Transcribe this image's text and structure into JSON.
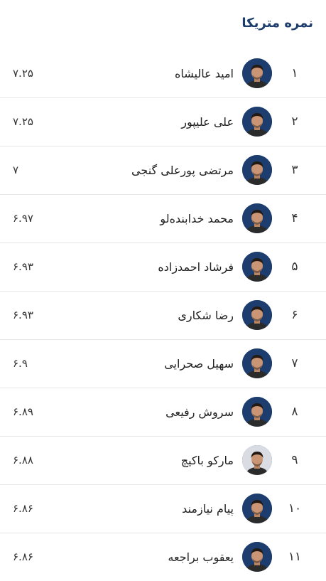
{
  "header": {
    "title": "نمره متریکا"
  },
  "players": [
    {
      "rank": "۱",
      "name": "امید عالیشاه",
      "score": "۷.۲۵",
      "avatar": "player-photo",
      "avatar_bg": "#1c3d6e"
    },
    {
      "rank": "۲",
      "name": "علی علیپور",
      "score": "۷.۲۵",
      "avatar": "player-photo",
      "avatar_bg": "#1c3d6e"
    },
    {
      "rank": "۳",
      "name": "مرتضی پورعلی گنجی",
      "score": "۷",
      "avatar": "player-photo",
      "avatar_bg": "#1c3d6e"
    },
    {
      "rank": "۴",
      "name": "محمد خدابنده‌لو",
      "score": "۶.۹۷",
      "avatar": "player-photo",
      "avatar_bg": "#1c3d6e"
    },
    {
      "rank": "۵",
      "name": "فرشاد احمدزاده",
      "score": "۶.۹۳",
      "avatar": "player-photo",
      "avatar_bg": "#1c3d6e"
    },
    {
      "rank": "۶",
      "name": "رضا شکاری",
      "score": "۶.۹۳",
      "avatar": "player-photo",
      "avatar_bg": "#1c3d6e"
    },
    {
      "rank": "۷",
      "name": "سهیل صحرایی",
      "score": "۶.۹",
      "avatar": "player-photo",
      "avatar_bg": "#1c3d6e"
    },
    {
      "rank": "۸",
      "name": "سروش رفیعی",
      "score": "۶.۸۹",
      "avatar": "player-photo",
      "avatar_bg": "#1c3d6e"
    },
    {
      "rank": "۹",
      "name": "مارکو باکیچ",
      "score": "۶.۸۸",
      "avatar": "player-photo",
      "avatar_bg": "#d9dde3"
    },
    {
      "rank": "۱۰",
      "name": "پیام نیازمند",
      "score": "۶.۸۶",
      "avatar": "player-photo",
      "avatar_bg": "#1c3d6e"
    },
    {
      "rank": "۱۱",
      "name": "یعقوب براجعه",
      "score": "۶.۸۶",
      "avatar": "player-photo",
      "avatar_bg": "#1c3d6e"
    }
  ],
  "colors": {
    "title": "#1c3d6e",
    "divider": "#e6e6e6",
    "avatar_bg": "#1c3d6e"
  }
}
